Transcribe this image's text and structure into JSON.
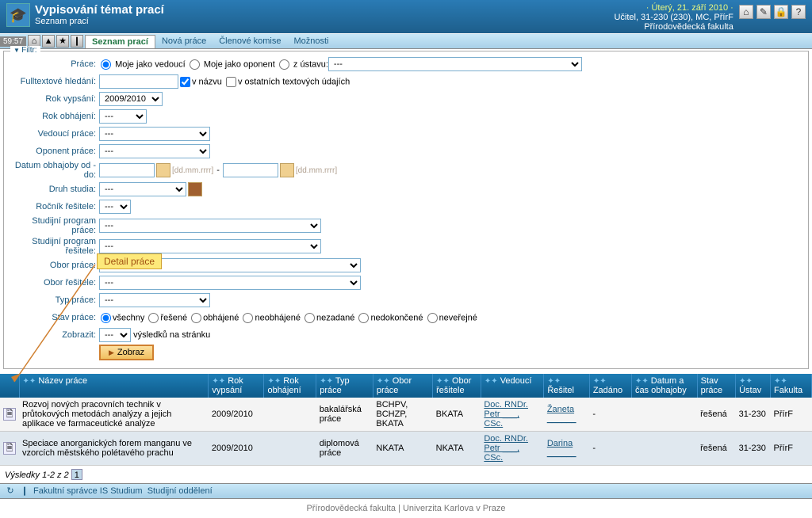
{
  "header": {
    "title": "Vypisování témat prací",
    "subtitle": "Seznam prací",
    "date": "· Úterý, 21. září 2010 ·",
    "user": "Učitel, 31-230 (230), MC, PřírF",
    "faculty": "Přírodovědecká fakulta"
  },
  "toolbar": {
    "clock": "59:57",
    "tabs": [
      "Seznam prací",
      "Nová práce",
      "Členové komise",
      "Možnosti"
    ]
  },
  "filter": {
    "legend": "Filtr:",
    "fields": {
      "prace": "Práce:",
      "prace_opts": [
        "Moje jako vedoucí",
        "Moje jako oponent",
        "z ústavu:"
      ],
      "ustav_sel": "---",
      "fulltext": "Fulltextové hledání:",
      "v_nazvu": "v názvu",
      "v_ostatnich": "v ostatních textových údajích",
      "rok_vypsani": "Rok vypsání:",
      "rok_vypsani_val": "2009/2010",
      "rok_obhajeni": "Rok obhájení:",
      "vedouci": "Vedoucí práce:",
      "oponent": "Oponent práce:",
      "datum_obhajoby": "Datum obhajoby od - do:",
      "datum_hint": "[dd.mm.rrrr]",
      "druh_studia": "Druh studia:",
      "rocnik": "Ročník řešitele:",
      "st_program_prace": "Studijní program práce:",
      "st_program_resitele": "Studijní program řešitele:",
      "obor_prace": "Obor práce:",
      "obor_resitele": "Obor řešitele:",
      "typ_prace": "Typ práce:",
      "stav_prace": "Stav práce:",
      "stav_opts": [
        "všechny",
        "řešené",
        "obhájené",
        "neobhájené",
        "nezadané",
        "nedokončené",
        "neveřejné"
      ],
      "zobrazit": "Zobrazit:",
      "zobrazit_suffix": "výsledků na stránku",
      "dash": "---",
      "zobraz_btn": "Zobraz"
    }
  },
  "annotation": "Detail práce",
  "table": {
    "headers": [
      "",
      "Název práce",
      "Rok vypsání",
      "Rok obhájení",
      "Typ práce",
      "Obor práce",
      "Obor řešitele",
      "Vedoucí",
      "Řešitel",
      "Zadáno",
      "Datum a čas obhajoby",
      "Stav práce",
      "Ústav",
      "Fakulta"
    ],
    "rows": [
      {
        "nazev": "Rozvoj nových pracovních technik v průtokových metodách analýzy a jejich aplikace ve farmaceutické analýze",
        "rok_vypsani": "2009/2010",
        "rok_obhajeni": "",
        "typ": "bakalářská práce",
        "obor_prace": "BCHPV, BCHZP, BKATA",
        "obor_resitele": "BKATA",
        "vedouci": "Doc. RNDr. Petr ___, CSc.",
        "resitel": "Žaneta ______",
        "zadano": "-",
        "datum": "",
        "stav": "řešená",
        "ustav": "31-230",
        "fakulta": "PřírF"
      },
      {
        "nazev": "Speciace anorganických forem manganu ve vzorcích městského polétavého prachu",
        "rok_vypsani": "2009/2010",
        "rok_obhajeni": "",
        "typ": "diplomová práce",
        "obor_prace": "NKATA",
        "obor_resitele": "NKATA",
        "vedouci": "Doc. RNDr. Petr ___, CSc.",
        "resitel": "Darina ______",
        "zadano": "-",
        "datum": "",
        "stav": "řešená",
        "ustav": "31-230",
        "fakulta": "PřírF"
      }
    ]
  },
  "pager": {
    "text": "Výsledky 1-2 z 2",
    "page": "1"
  },
  "bottombar": {
    "item1": "Fakultní správce IS Studium",
    "item2": "Studijní oddělení"
  },
  "footer": {
    "left": "Přírodovědecká fakulta",
    "sep": " | ",
    "right": "Univerzita Karlova v Praze"
  }
}
